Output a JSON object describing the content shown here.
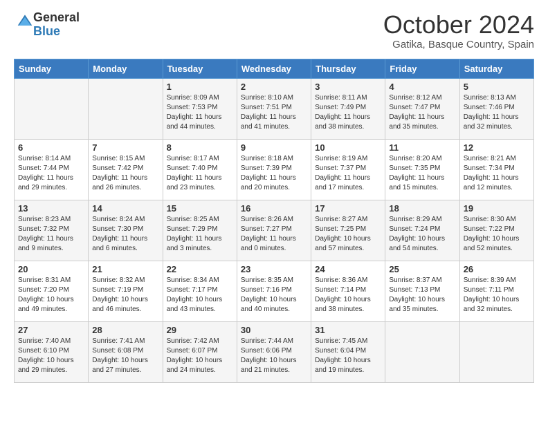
{
  "logo": {
    "general": "General",
    "blue": "Blue"
  },
  "title": "October 2024",
  "location": "Gatika, Basque Country, Spain",
  "days_of_week": [
    "Sunday",
    "Monday",
    "Tuesday",
    "Wednesday",
    "Thursday",
    "Friday",
    "Saturday"
  ],
  "weeks": [
    [
      {
        "day": "",
        "sunrise": "",
        "sunset": "",
        "daylight": ""
      },
      {
        "day": "",
        "sunrise": "",
        "sunset": "",
        "daylight": ""
      },
      {
        "day": "1",
        "sunrise": "Sunrise: 8:09 AM",
        "sunset": "Sunset: 7:53 PM",
        "daylight": "Daylight: 11 hours and 44 minutes."
      },
      {
        "day": "2",
        "sunrise": "Sunrise: 8:10 AM",
        "sunset": "Sunset: 7:51 PM",
        "daylight": "Daylight: 11 hours and 41 minutes."
      },
      {
        "day": "3",
        "sunrise": "Sunrise: 8:11 AM",
        "sunset": "Sunset: 7:49 PM",
        "daylight": "Daylight: 11 hours and 38 minutes."
      },
      {
        "day": "4",
        "sunrise": "Sunrise: 8:12 AM",
        "sunset": "Sunset: 7:47 PM",
        "daylight": "Daylight: 11 hours and 35 minutes."
      },
      {
        "day": "5",
        "sunrise": "Sunrise: 8:13 AM",
        "sunset": "Sunset: 7:46 PM",
        "daylight": "Daylight: 11 hours and 32 minutes."
      }
    ],
    [
      {
        "day": "6",
        "sunrise": "Sunrise: 8:14 AM",
        "sunset": "Sunset: 7:44 PM",
        "daylight": "Daylight: 11 hours and 29 minutes."
      },
      {
        "day": "7",
        "sunrise": "Sunrise: 8:15 AM",
        "sunset": "Sunset: 7:42 PM",
        "daylight": "Daylight: 11 hours and 26 minutes."
      },
      {
        "day": "8",
        "sunrise": "Sunrise: 8:17 AM",
        "sunset": "Sunset: 7:40 PM",
        "daylight": "Daylight: 11 hours and 23 minutes."
      },
      {
        "day": "9",
        "sunrise": "Sunrise: 8:18 AM",
        "sunset": "Sunset: 7:39 PM",
        "daylight": "Daylight: 11 hours and 20 minutes."
      },
      {
        "day": "10",
        "sunrise": "Sunrise: 8:19 AM",
        "sunset": "Sunset: 7:37 PM",
        "daylight": "Daylight: 11 hours and 17 minutes."
      },
      {
        "day": "11",
        "sunrise": "Sunrise: 8:20 AM",
        "sunset": "Sunset: 7:35 PM",
        "daylight": "Daylight: 11 hours and 15 minutes."
      },
      {
        "day": "12",
        "sunrise": "Sunrise: 8:21 AM",
        "sunset": "Sunset: 7:34 PM",
        "daylight": "Daylight: 11 hours and 12 minutes."
      }
    ],
    [
      {
        "day": "13",
        "sunrise": "Sunrise: 8:23 AM",
        "sunset": "Sunset: 7:32 PM",
        "daylight": "Daylight: 11 hours and 9 minutes."
      },
      {
        "day": "14",
        "sunrise": "Sunrise: 8:24 AM",
        "sunset": "Sunset: 7:30 PM",
        "daylight": "Daylight: 11 hours and 6 minutes."
      },
      {
        "day": "15",
        "sunrise": "Sunrise: 8:25 AM",
        "sunset": "Sunset: 7:29 PM",
        "daylight": "Daylight: 11 hours and 3 minutes."
      },
      {
        "day": "16",
        "sunrise": "Sunrise: 8:26 AM",
        "sunset": "Sunset: 7:27 PM",
        "daylight": "Daylight: 11 hours and 0 minutes."
      },
      {
        "day": "17",
        "sunrise": "Sunrise: 8:27 AM",
        "sunset": "Sunset: 7:25 PM",
        "daylight": "Daylight: 10 hours and 57 minutes."
      },
      {
        "day": "18",
        "sunrise": "Sunrise: 8:29 AM",
        "sunset": "Sunset: 7:24 PM",
        "daylight": "Daylight: 10 hours and 54 minutes."
      },
      {
        "day": "19",
        "sunrise": "Sunrise: 8:30 AM",
        "sunset": "Sunset: 7:22 PM",
        "daylight": "Daylight: 10 hours and 52 minutes."
      }
    ],
    [
      {
        "day": "20",
        "sunrise": "Sunrise: 8:31 AM",
        "sunset": "Sunset: 7:20 PM",
        "daylight": "Daylight: 10 hours and 49 minutes."
      },
      {
        "day": "21",
        "sunrise": "Sunrise: 8:32 AM",
        "sunset": "Sunset: 7:19 PM",
        "daylight": "Daylight: 10 hours and 46 minutes."
      },
      {
        "day": "22",
        "sunrise": "Sunrise: 8:34 AM",
        "sunset": "Sunset: 7:17 PM",
        "daylight": "Daylight: 10 hours and 43 minutes."
      },
      {
        "day": "23",
        "sunrise": "Sunrise: 8:35 AM",
        "sunset": "Sunset: 7:16 PM",
        "daylight": "Daylight: 10 hours and 40 minutes."
      },
      {
        "day": "24",
        "sunrise": "Sunrise: 8:36 AM",
        "sunset": "Sunset: 7:14 PM",
        "daylight": "Daylight: 10 hours and 38 minutes."
      },
      {
        "day": "25",
        "sunrise": "Sunrise: 8:37 AM",
        "sunset": "Sunset: 7:13 PM",
        "daylight": "Daylight: 10 hours and 35 minutes."
      },
      {
        "day": "26",
        "sunrise": "Sunrise: 8:39 AM",
        "sunset": "Sunset: 7:11 PM",
        "daylight": "Daylight: 10 hours and 32 minutes."
      }
    ],
    [
      {
        "day": "27",
        "sunrise": "Sunrise: 7:40 AM",
        "sunset": "Sunset: 6:10 PM",
        "daylight": "Daylight: 10 hours and 29 minutes."
      },
      {
        "day": "28",
        "sunrise": "Sunrise: 7:41 AM",
        "sunset": "Sunset: 6:08 PM",
        "daylight": "Daylight: 10 hours and 27 minutes."
      },
      {
        "day": "29",
        "sunrise": "Sunrise: 7:42 AM",
        "sunset": "Sunset: 6:07 PM",
        "daylight": "Daylight: 10 hours and 24 minutes."
      },
      {
        "day": "30",
        "sunrise": "Sunrise: 7:44 AM",
        "sunset": "Sunset: 6:06 PM",
        "daylight": "Daylight: 10 hours and 21 minutes."
      },
      {
        "day": "31",
        "sunrise": "Sunrise: 7:45 AM",
        "sunset": "Sunset: 6:04 PM",
        "daylight": "Daylight: 10 hours and 19 minutes."
      },
      {
        "day": "",
        "sunrise": "",
        "sunset": "",
        "daylight": ""
      },
      {
        "day": "",
        "sunrise": "",
        "sunset": "",
        "daylight": ""
      }
    ]
  ]
}
